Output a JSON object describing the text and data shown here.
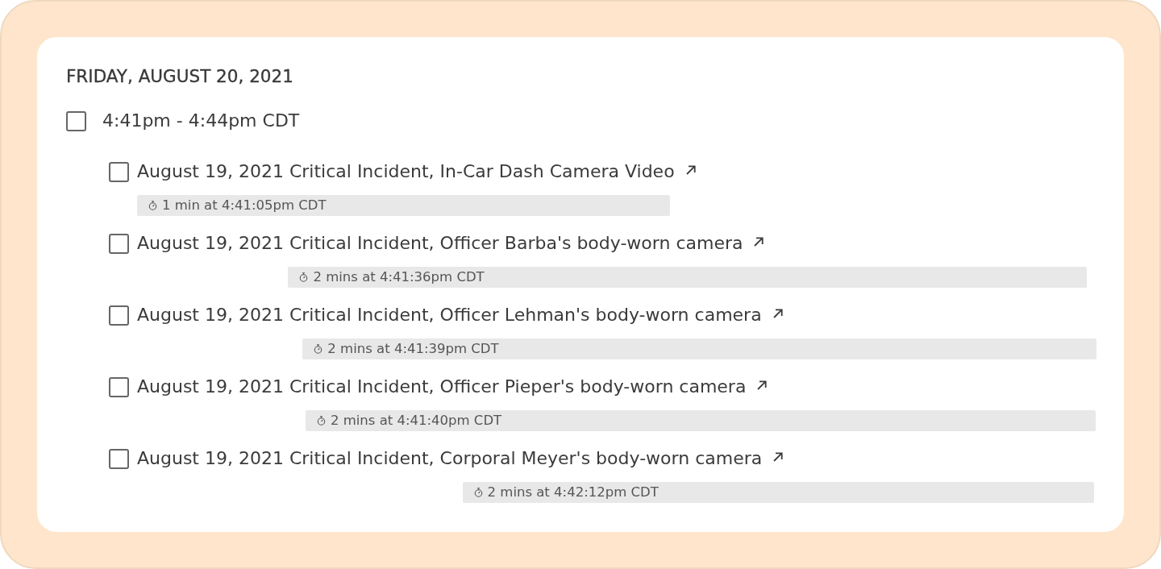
{
  "day": {
    "heading": "FRIDAY, AUGUST 20, 2021",
    "sessions": [
      {
        "label": "4:41pm - 4:44pm CDT",
        "checked": false,
        "videos": [
          {
            "title": "August 19, 2021 Critical Incident, In-Car Dash Camera Video",
            "checked": false,
            "duration": "1 min at 4:41:05pm CDT"
          },
          {
            "title": "August 19, 2021 Critical Incident, Officer Barba's body-worn camera",
            "checked": false,
            "duration": "2 mins at 4:41:36pm CDT"
          },
          {
            "title": "August 19, 2021 Critical Incident, Officer Lehman's body-worn camera",
            "checked": false,
            "duration": "2 mins at 4:41:39pm CDT"
          },
          {
            "title": "August 19, 2021 Critical Incident, Officer Pieper's body-worn camera",
            "checked": false,
            "duration": "2 mins at 4:41:40pm CDT"
          },
          {
            "title": "August 19, 2021 Critical Incident, Corporal Meyer's body-worn camera",
            "checked": false,
            "duration": "2 mins at 4:42:12pm CDT"
          }
        ]
      }
    ]
  }
}
